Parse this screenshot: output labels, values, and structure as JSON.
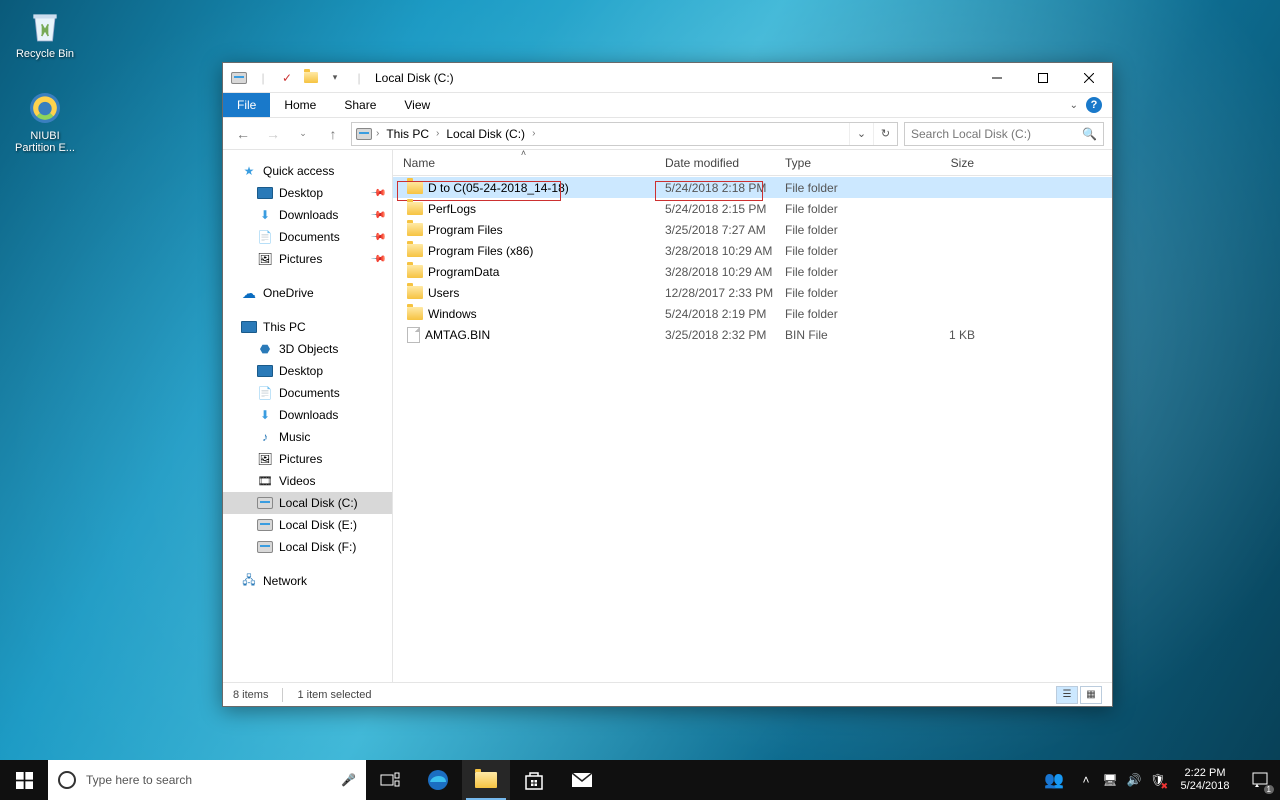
{
  "desktop": {
    "icons": [
      {
        "name": "recycle-bin",
        "label": "Recycle Bin"
      },
      {
        "name": "niubi-partition",
        "label": "NIUBI\nPartition E..."
      }
    ]
  },
  "window": {
    "title": "Local Disk (C:)",
    "ribbon": {
      "file": "File",
      "home": "Home",
      "share": "Share",
      "view": "View"
    },
    "breadcrumbs": [
      "This PC",
      "Local Disk (C:)"
    ],
    "search_placeholder": "Search Local Disk (C:)",
    "columns": {
      "name": "Name",
      "date": "Date modified",
      "type": "Type",
      "size": "Size"
    },
    "nav": {
      "quick_access": {
        "label": "Quick access",
        "items": [
          {
            "label": "Desktop",
            "pinned": true,
            "icon": "monitor"
          },
          {
            "label": "Downloads",
            "pinned": true,
            "icon": "down"
          },
          {
            "label": "Documents",
            "pinned": true,
            "icon": "doc"
          },
          {
            "label": "Pictures",
            "pinned": true,
            "icon": "pic"
          }
        ]
      },
      "onedrive": {
        "label": "OneDrive"
      },
      "this_pc": {
        "label": "This PC",
        "items": [
          {
            "label": "3D Objects"
          },
          {
            "label": "Desktop"
          },
          {
            "label": "Documents"
          },
          {
            "label": "Downloads"
          },
          {
            "label": "Music"
          },
          {
            "label": "Pictures"
          },
          {
            "label": "Videos"
          },
          {
            "label": "Local Disk (C:)",
            "active": true,
            "disk": true
          },
          {
            "label": "Local Disk (E:)",
            "disk": true
          },
          {
            "label": "Local Disk (F:)",
            "disk": true
          }
        ]
      },
      "network": {
        "label": "Network"
      }
    },
    "files": [
      {
        "name": "D to C(05-24-2018_14-18)",
        "date": "5/24/2018 2:18 PM",
        "type": "File folder",
        "size": "",
        "kind": "folder",
        "selected": true,
        "highlight_name": true,
        "highlight_date": true
      },
      {
        "name": "PerfLogs",
        "date": "5/24/2018 2:15 PM",
        "type": "File folder",
        "size": "",
        "kind": "folder"
      },
      {
        "name": "Program Files",
        "date": "3/25/2018 7:27 AM",
        "type": "File folder",
        "size": "",
        "kind": "folder"
      },
      {
        "name": "Program Files (x86)",
        "date": "3/28/2018 10:29 AM",
        "type": "File folder",
        "size": "",
        "kind": "folder"
      },
      {
        "name": "ProgramData",
        "date": "3/28/2018 10:29 AM",
        "type": "File folder",
        "size": "",
        "kind": "folder"
      },
      {
        "name": "Users",
        "date": "12/28/2017 2:33 PM",
        "type": "File folder",
        "size": "",
        "kind": "folder"
      },
      {
        "name": "Windows",
        "date": "5/24/2018 2:19 PM",
        "type": "File folder",
        "size": "",
        "kind": "folder"
      },
      {
        "name": "AMTAG.BIN",
        "date": "3/25/2018 2:32 PM",
        "type": "BIN File",
        "size": "1 KB",
        "kind": "file"
      }
    ],
    "status": {
      "count": "8 items",
      "selection": "1 item selected"
    }
  },
  "taskbar": {
    "search_placeholder": "Type here to search",
    "time": "2:22 PM",
    "date": "5/24/2018"
  }
}
